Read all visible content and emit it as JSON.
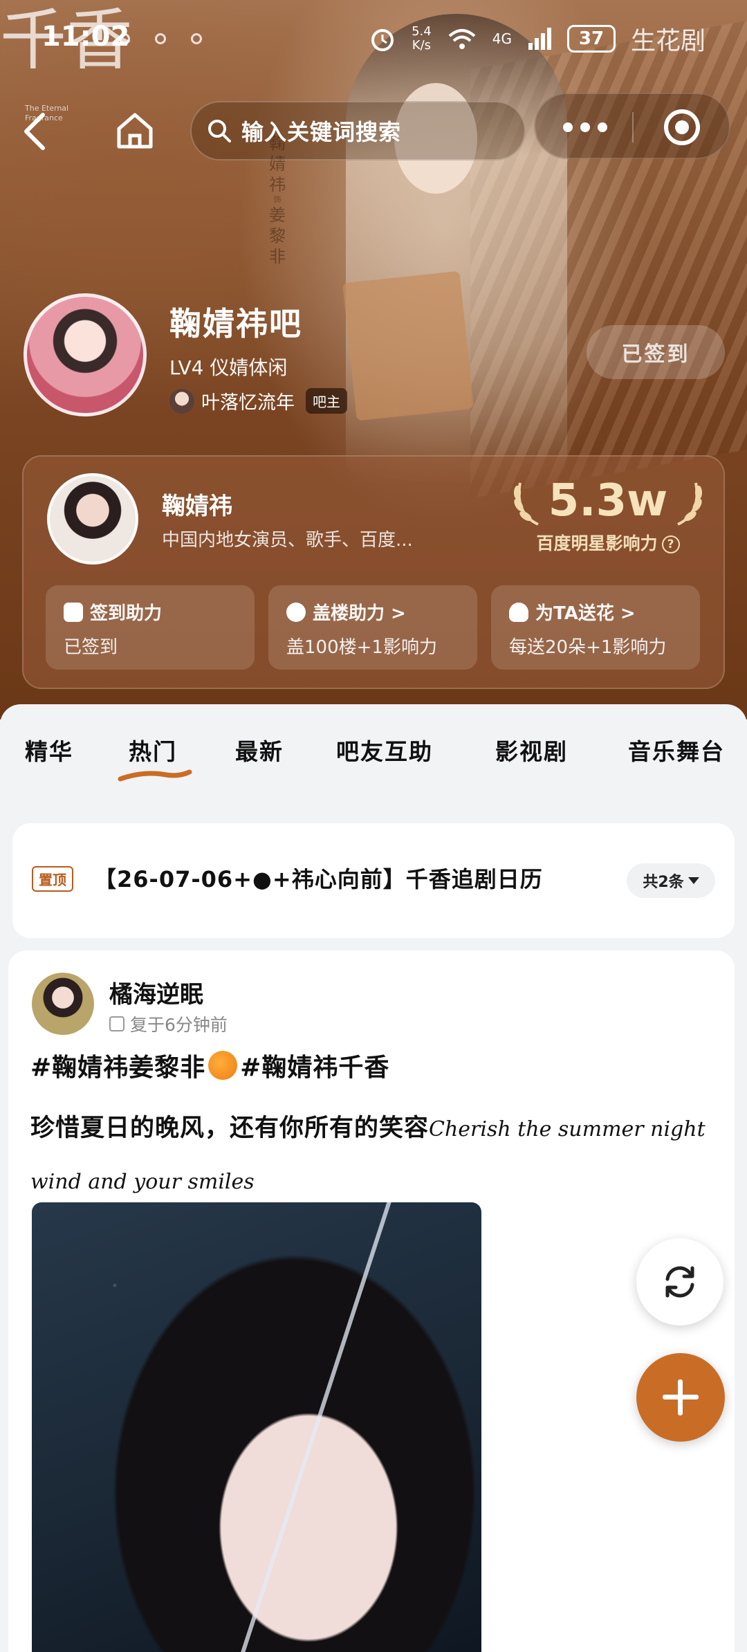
{
  "status_bar": {
    "time": "11:02",
    "net_speed_value": "5.4",
    "net_speed_unit": "K/s",
    "signal": "4G",
    "battery": "37",
    "watermark": "生花剧"
  },
  "hero": {
    "brand_logo": "千香",
    "brand_sub_line1": "The Eternal",
    "brand_sub_line2": "Fragrance",
    "vertical_caption_1": "鞠婧祎",
    "vertical_caption_sep": "饰",
    "vertical_caption_2": "姜黎非"
  },
  "nav": {
    "search_placeholder": "输入关键词搜索",
    "icons": [
      "back-icon",
      "home-icon",
      "search-icon",
      "more-icon",
      "target-icon"
    ]
  },
  "bar": {
    "title": "鞠婧祎吧",
    "level": "LV4 仪婧体闲",
    "owner_name": "叶落忆流年",
    "owner_badge": "吧主",
    "sign_button": "已签到"
  },
  "celebrity": {
    "name": "鞠婧祎",
    "description": "中国内地女演员、歌手、百度...",
    "influence_value": "5.3w",
    "influence_label": "百度明星影响力",
    "tiles": [
      {
        "title": "签到助力",
        "subtitle": "已签到",
        "icon": "calendar-icon"
      },
      {
        "title": "盖楼助力 >",
        "subtitle": "盖100楼+1影响力",
        "icon": "chat-icon"
      },
      {
        "title": "为TA送花 >",
        "subtitle": "每送20朵+1影响力",
        "icon": "flower-icon"
      }
    ]
  },
  "tabs": [
    {
      "label": "精华",
      "active": false
    },
    {
      "label": "热门",
      "active": true
    },
    {
      "label": "最新",
      "active": false
    },
    {
      "label": "吧友互助",
      "active": false
    },
    {
      "label": "影视剧",
      "active": false
    },
    {
      "label": "音乐舞台",
      "active": false
    }
  ],
  "pinned": {
    "tag": "置顶",
    "title": "【26-07-06+●+祎心向前】千香追剧日历",
    "count": "共2条"
  },
  "post": {
    "author": "橘海逆眠",
    "meta": "复于6分钟前",
    "tags_part1": "#鞠婧祎姜黎非",
    "tags_part2": "#鞠婧祎千香",
    "body_cn": "珍惜夏日的晚风，还有你所有的笑容",
    "body_en": "Cherish the summer night wind and your smiles"
  },
  "colors": {
    "accent": "#c96d26",
    "pinned_tag": "#b85b1c",
    "header_brown": "#7a4422"
  }
}
